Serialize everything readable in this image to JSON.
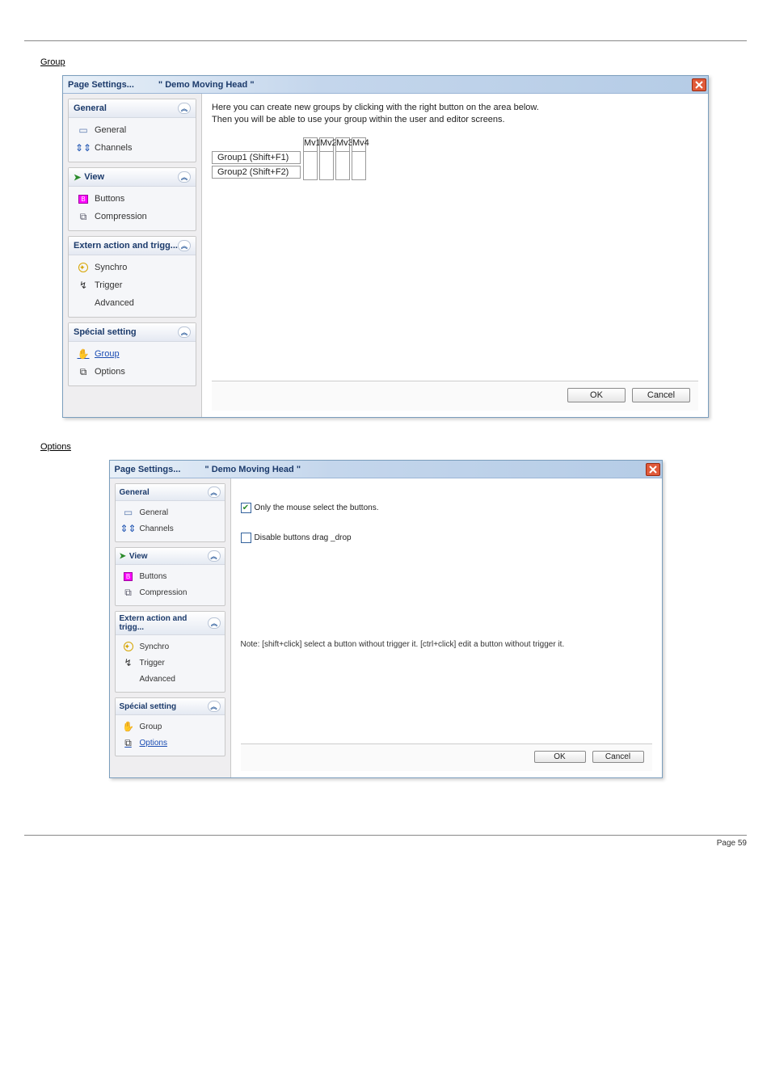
{
  "sections": {
    "group": "Group",
    "options": "Options"
  },
  "group_intro_1": "Here you can create new groups by clicking with the right button on the area below.",
  "group_intro_2": "Then you will be able to use your group within the user and editor screens.",
  "dialog": {
    "title_left": "Page  Settings...",
    "title_mid": "\" Demo Moving Head \"",
    "ok": "OK",
    "cancel": "Cancel"
  },
  "nav": {
    "general": {
      "header": "General",
      "items": [
        "General",
        "Channels"
      ]
    },
    "view": {
      "header": "View",
      "items": [
        "Buttons",
        "Compression"
      ]
    },
    "extern": {
      "header": "Extern action and trigg...",
      "items": [
        "Synchro",
        "Trigger",
        "Advanced"
      ]
    },
    "special": {
      "header": "Spécial setting",
      "group": "Group",
      "options": "Options"
    }
  },
  "groups": {
    "g1": "Group1 (Shift+F1)",
    "g2": "Group2 (Shift+F2)",
    "fixtures": [
      "Mv1",
      "Mv2",
      "Mv3",
      "Mv4"
    ]
  },
  "options_pane": {
    "chk1": "Only the mouse select the buttons.",
    "chk2": "Disable buttons drag _drop",
    "note": "Note: [shift+click] select a button without trigger it.  [ctrl+click] edit a button without trigger it."
  },
  "page_number": "Page 59"
}
